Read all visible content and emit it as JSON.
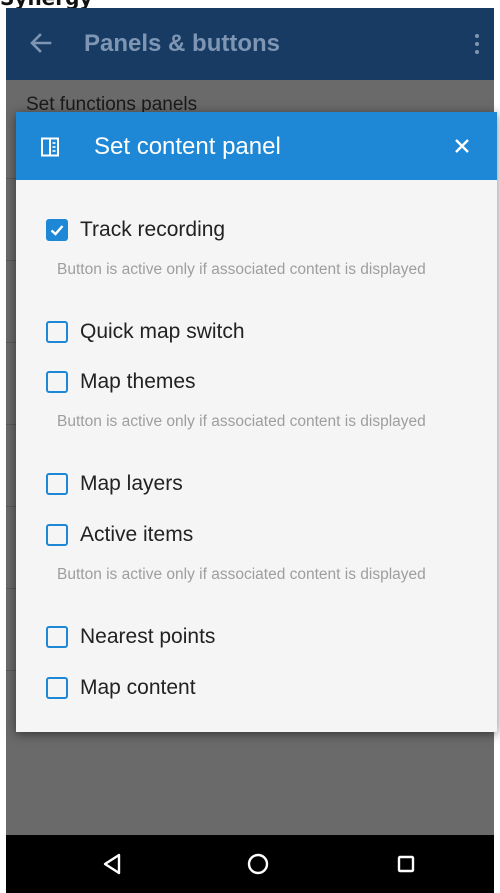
{
  "colors": {
    "app_bar": "#173b63",
    "dialog_header": "#1e88d6",
    "checkbox": "#1e88d6",
    "hint_text": "#9e9e9e",
    "nav_bar": "#000000"
  },
  "page_heading_cut": "Synergy",
  "app_bar": {
    "back_icon": "arrow-left-icon",
    "title": "Panels & buttons",
    "menu_icon": "more-vert-icon"
  },
  "background": {
    "section_label": "Set functions panels"
  },
  "dialog": {
    "icon": "panel-icon",
    "title": "Set content panel",
    "close_icon": "close-icon",
    "options": [
      {
        "label": "Track recording",
        "checked": true,
        "hint": "Button is active only if associated content is displayed"
      },
      {
        "label": "Quick map switch",
        "checked": false
      },
      {
        "label": "Map themes",
        "checked": false,
        "hint": "Button is active only if associated content is displayed"
      },
      {
        "label": "Map layers",
        "checked": false
      },
      {
        "label": "Active items",
        "checked": false,
        "hint": "Button is active only if associated content is displayed"
      },
      {
        "label": "Nearest points",
        "checked": false
      },
      {
        "label": "Map content",
        "checked": false
      }
    ]
  },
  "nav_bar": {
    "back": "nav-back-icon",
    "home": "nav-home-icon",
    "recents": "nav-recents-icon"
  }
}
